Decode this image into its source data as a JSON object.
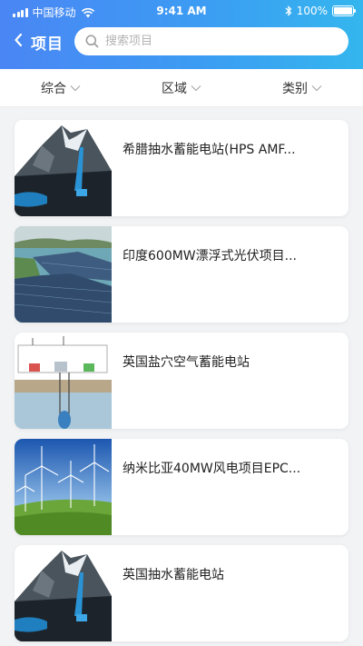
{
  "status_bar": {
    "carrier": "中国移动",
    "time": "9:41 AM",
    "battery": "100%"
  },
  "header": {
    "title": "项目",
    "search_placeholder": "搜索项目"
  },
  "filters": [
    {
      "label": "综合"
    },
    {
      "label": "区域"
    },
    {
      "label": "类别"
    }
  ],
  "projects": [
    {
      "title": "希腊抽水蓄能电站(HPS AMF...",
      "image": "mountain-reservoir"
    },
    {
      "title": "印度600MW漂浮式光伏项目...",
      "image": "floating-solar"
    },
    {
      "title": "英国盐穴空气蓄能电站",
      "image": "salt-cavern-diagram"
    },
    {
      "title": "纳米比亚40MW风电项目EPC...",
      "image": "wind-farm"
    },
    {
      "title": "英国抽水蓄能电站",
      "image": "mountain-reservoir"
    }
  ]
}
